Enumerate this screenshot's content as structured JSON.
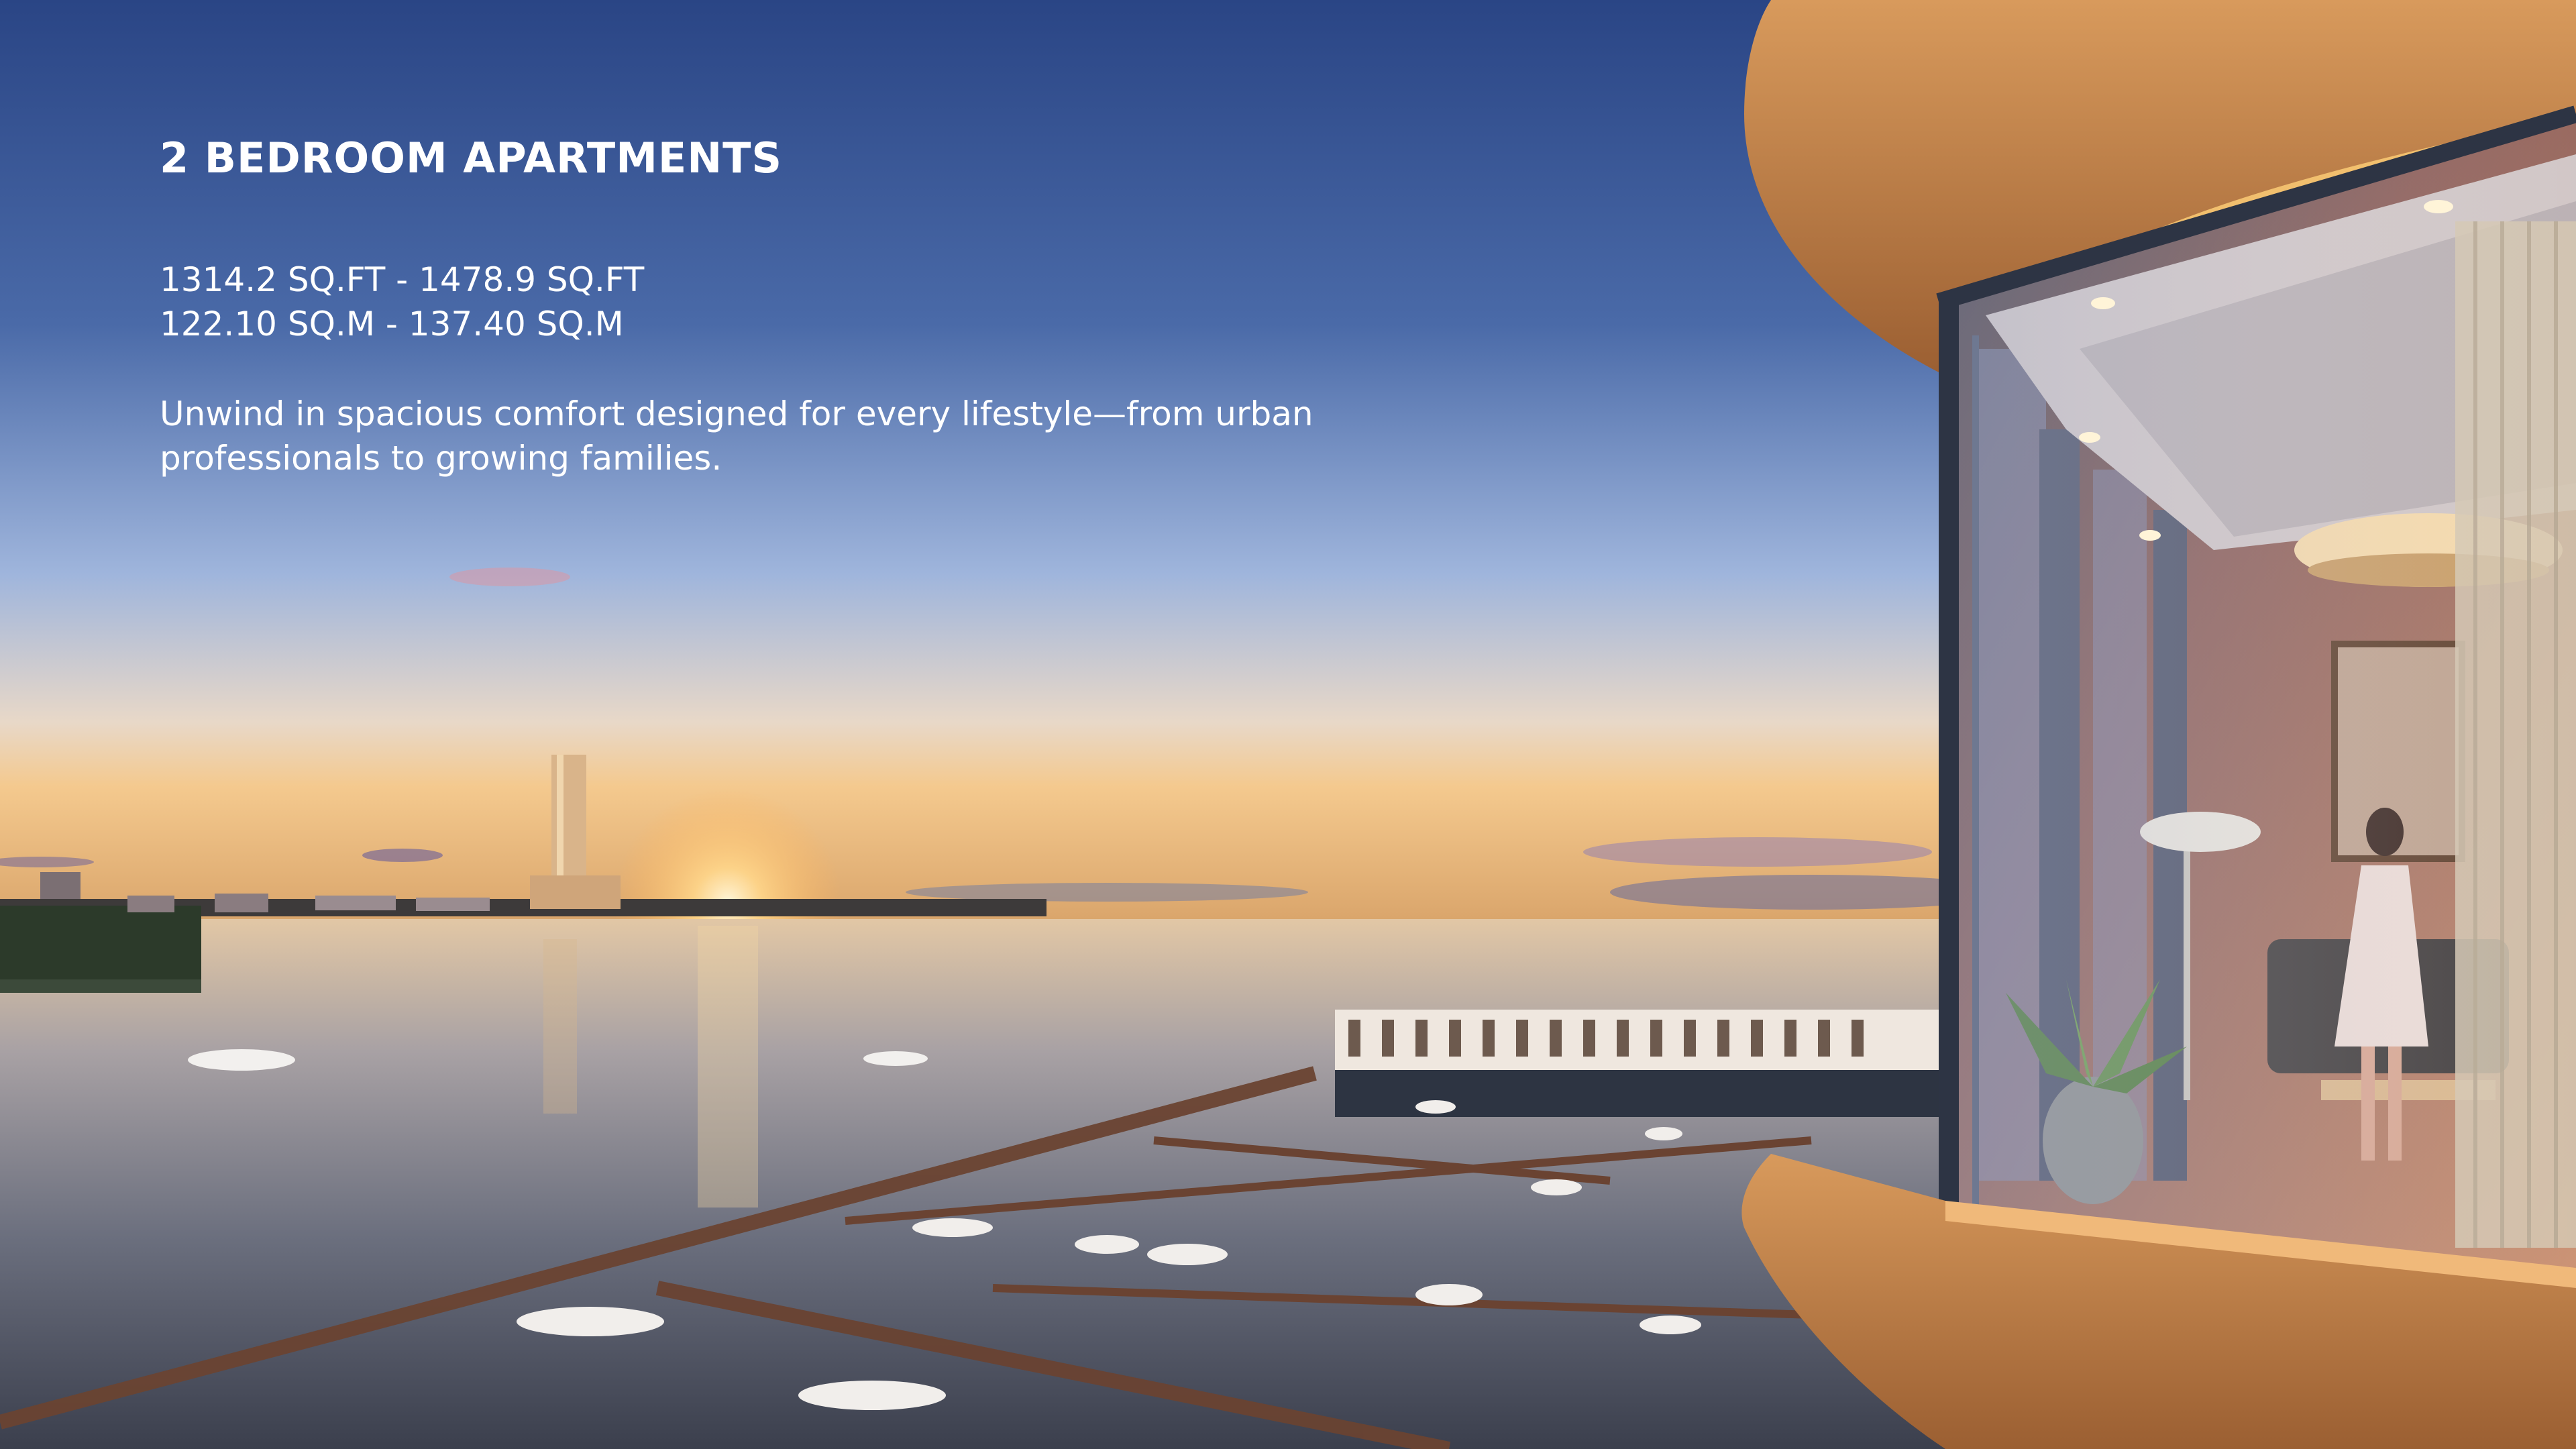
{
  "heading": {
    "title": "2 BEDROOM APARTMENTS"
  },
  "specs": {
    "area_sqft": "1314.2 SQ.FT - 1478.9 SQ.FT",
    "area_sqm": "122.10 SQ.M - 137.40 SQ.M"
  },
  "description": "Unwind in spacious comfort designed for every lifestyle—from urban professionals to growing families.",
  "colors": {
    "sky_top": "#2f4d8c",
    "sky_mid": "#7d9bd0",
    "horizon_glow": "#f6d49a",
    "water": "#8e8a8c",
    "balcony_wood": "#c98a4e",
    "text": "#ffffff"
  }
}
